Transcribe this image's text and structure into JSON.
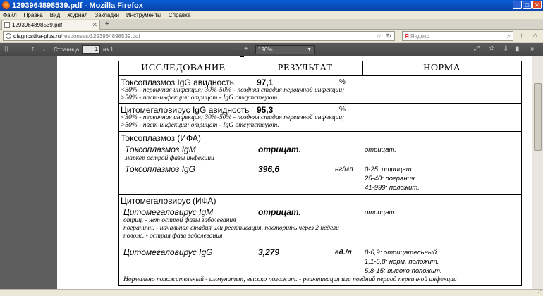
{
  "window": {
    "title": "1293964898539.pdf - Mozilla Firefox"
  },
  "menu": [
    "Файл",
    "Правка",
    "Вид",
    "Журнал",
    "Закладки",
    "Инструменты",
    "Справка"
  ],
  "tab": {
    "label": "1293964898539.pdf"
  },
  "nav": {
    "url_host": "diagnostika-plus.ru",
    "url_path": "/responses/1293964898539.pdf",
    "search_placeholder": "Яндекс",
    "search_logo": "Я"
  },
  "pdf_toolbar": {
    "page_label": "Страница:",
    "page_value": "1",
    "page_count": "из 1",
    "zoom": "190%",
    "zoom_minus": "—",
    "zoom_plus": "+"
  },
  "doc": {
    "headers": [
      "ИССЛЕДОВАНИЕ",
      "РЕЗУЛЬТАТ",
      "НОРМА"
    ],
    "avidity_toxo": {
      "title": "Токсоплазмоз IgG авидность",
      "value": "97,1",
      "unit": "%",
      "note1": "<30%  -  первичная инфекция;  30%-50%  -  поздняя стадия первичной инфекции;",
      "note2": ">50% - паст-инфекция;  отрицат - IgG отсутствуют."
    },
    "avidity_cmv": {
      "title": "Цитомегаловирус IgG авидность",
      "value": "95,3",
      "unit": "%",
      "note1": "<30%  -  первичная инфекция;  30%-50%  -  поздняя стадия первичной инфекции;",
      "note2": ">50% - паст-инфекция;  отрицат - IgG отсутствуют."
    },
    "toxo_ifa": {
      "title": "Токсоплазмоз (ИФА)",
      "igm_label": "Токсоплазмоз IgM",
      "igm_value": "отрицат.",
      "igm_norm": "отрицат.",
      "igm_note": "маркер острой фазы инфекции",
      "igg_label": "Токсоплазмоз IgG",
      "igg_value": "396,6",
      "igg_unit": "нг/мл",
      "igg_norm1": "0-25: отрицат.",
      "igg_norm2": "25-40: погранич.",
      "igg_norm3": "41-999: положит."
    },
    "cmv_ifa": {
      "title": "Цитомегаловирус (ИФА)",
      "igm_label": "Цитомегаловирус IgM",
      "igm_value": "отрицат.",
      "igm_norm": "отрицат.",
      "igm_note1": "отриц. -  нет острой фазы заболевания",
      "igm_note2": "пограничн. -  начальная стадия или реактивация,  повторить через 2  недели",
      "igm_note3": "полож. -  острая фаза заболевания",
      "igg_label": "Цитомегаловирус IgG",
      "igg_value": "3,279",
      "igg_unit": "ед./л",
      "igg_norm1": "0-0,9: отрицательный",
      "igg_norm2": "1,1-5,8: норм. положит.",
      "igg_norm3": "5,8-15: высоко положит.",
      "igg_note": "Нормально положительный -  иммунитет,  высоко положит.  -  реактивация или поздний период первичной инфекции"
    }
  }
}
